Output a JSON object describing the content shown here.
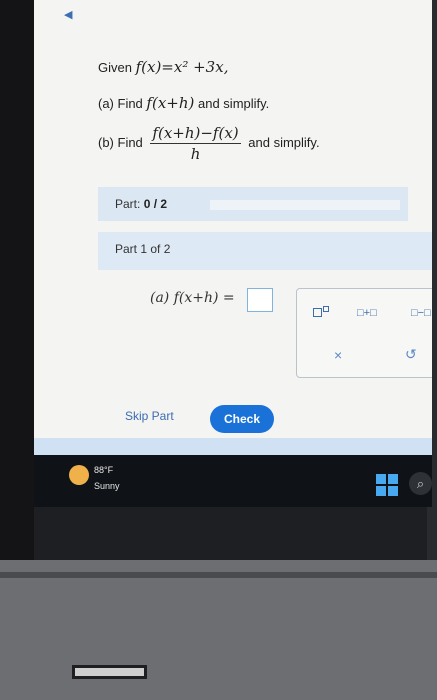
{
  "question": {
    "given_prefix": "Given",
    "given_expr": "f(x)=x² +3x,",
    "part_a_label": "(a) Find",
    "part_a_expr": "f(x+h)",
    "part_a_suffix": "and simplify.",
    "part_b_label": "(b) Find",
    "part_b_numerator": "f(x+h)−f(x)",
    "part_b_denominator": "h",
    "part_b_suffix": "and simplify."
  },
  "progress": {
    "label": "Part:",
    "value": "0 / 2",
    "completed": 0,
    "total": 2
  },
  "part_header": "Part 1 of 2",
  "answer": {
    "prompt": "(a) f(x+h) =",
    "value": ""
  },
  "palette": {
    "superscript_label": "□□",
    "plus_label": "□+□",
    "minus_label": "□−□",
    "clear_label": "×",
    "undo_label": "↺"
  },
  "buttons": {
    "skip": "Skip Part",
    "check": "Check"
  },
  "taskbar": {
    "temperature": "88°F",
    "condition": "Sunny"
  },
  "colors": {
    "accent": "#1a72d9",
    "link": "#3c6cb3",
    "part_bar": "#dbe8f3"
  }
}
